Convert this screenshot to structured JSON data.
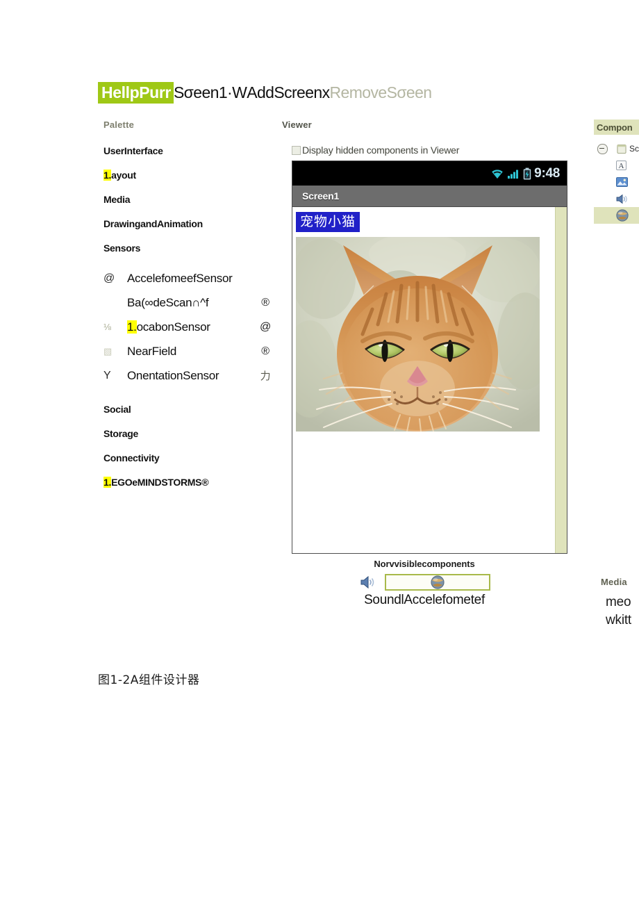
{
  "header": {
    "project_badge": "HellpPurr",
    "screen_selector": "Sσeen1·W",
    "add_screen": "AddScreenx",
    "remove_screen": "RemoveSσeen",
    "badge_color": "#9fc816"
  },
  "palette": {
    "title": "Palette",
    "categories": [
      {
        "label": "UserInterface",
        "highlight": ""
      },
      {
        "label": "ayout",
        "highlight": "1."
      },
      {
        "label": "Media",
        "highlight": ""
      },
      {
        "label": "DrawingandAnimation",
        "highlight": ""
      },
      {
        "label": "Sensors",
        "highlight": ""
      }
    ],
    "sensors": [
      {
        "icon_left": "@",
        "name": "AccelefomeefSensor",
        "icon_right": "",
        "highlight": ""
      },
      {
        "icon_left": "",
        "name": "Ba(∞deScan∩^f",
        "icon_right": "®",
        "highlight": ""
      },
      {
        "icon_left": "⅛",
        "name": "ocabonSensor",
        "icon_right": "@",
        "highlight": "1."
      },
      {
        "icon_left": "▧",
        "name": "NearField",
        "icon_right": "®",
        "highlight": ""
      },
      {
        "icon_left": "Y",
        "name": "OnentationSensor",
        "icon_right": "力",
        "highlight": ""
      }
    ],
    "categories_lower": [
      {
        "label": "Social",
        "highlight": ""
      },
      {
        "label": "Storage",
        "highlight": ""
      },
      {
        "label": "Connectivity",
        "highlight": ""
      },
      {
        "label": "EGOeMINDSTORMS®",
        "highlight": "1."
      }
    ]
  },
  "viewer": {
    "title": "Viewer",
    "hidden_components_label": "Display hidden components in Viewer",
    "hidden_components_checked": false,
    "phone": {
      "status_time": "9:48",
      "status_icons": [
        "wifi-icon",
        "signal-icon",
        "battery-icon"
      ],
      "title_bar": "Screen1",
      "app_label": "宠物小猫",
      "app_label_bg": "#2020c8",
      "rail_color": "#dfe3bb",
      "photo": "orange-tabby-cat-photo"
    }
  },
  "nonvisible": {
    "title": "Norvvisiblecomponents",
    "icons": [
      "sound-icon",
      "accelerometer-icon"
    ],
    "names": "SoundlAccelefometef"
  },
  "components_panel": {
    "title": "Compon",
    "tree": [
      {
        "icon": "screen-icon",
        "label": "Sc",
        "selected": false,
        "indent": false
      },
      {
        "icon": "label-icon",
        "label": "",
        "selected": false,
        "indent": true
      },
      {
        "icon": "image-icon",
        "label": "",
        "selected": false,
        "indent": true
      },
      {
        "icon": "sound-icon",
        "label": "",
        "selected": false,
        "indent": true
      },
      {
        "icon": "accelerometer-icon",
        "label": "",
        "selected": true,
        "indent": true
      }
    ]
  },
  "media_panel": {
    "title": "Media",
    "items": [
      "meo",
      "wkitt"
    ]
  },
  "caption": "图1-2A组件设计器"
}
